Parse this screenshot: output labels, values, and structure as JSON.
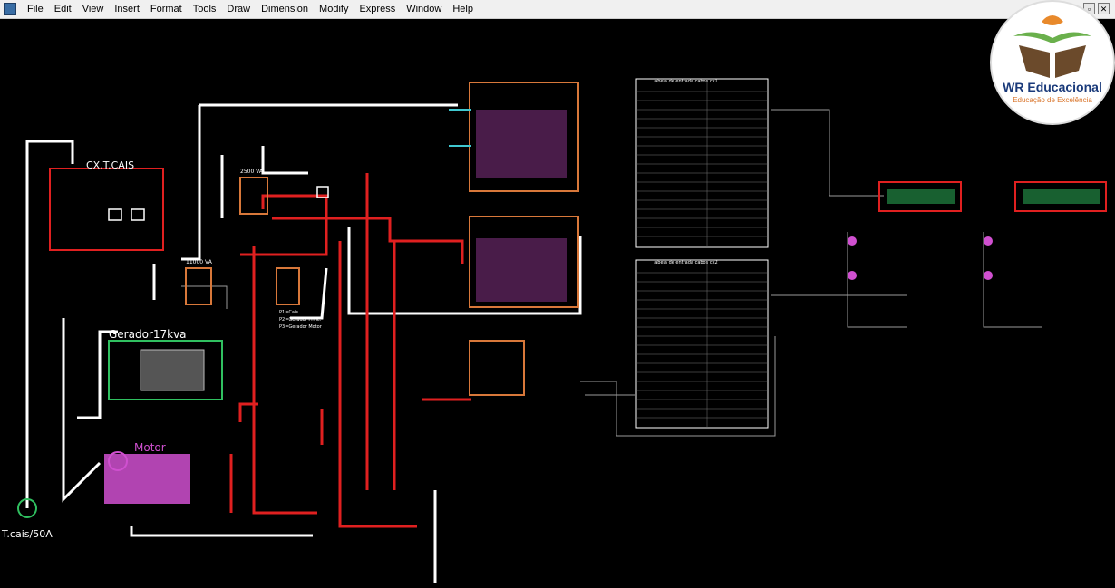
{
  "menu": {
    "items": [
      "File",
      "Edit",
      "View",
      "Insert",
      "Format",
      "Tools",
      "Draw",
      "Dimension",
      "Modify",
      "Express",
      "Window",
      "Help"
    ],
    "window_controls": [
      "▫",
      "✕"
    ]
  },
  "drawing": {
    "labels": {
      "cx_tcais": "CX.T.CAIS",
      "gerador": "Gerador17kva",
      "motor": "Motor",
      "tcais": "T.cais/50A",
      "kva_11000": "11000 VA",
      "kva_2500": "2500 VA",
      "p1": "P1=Cais",
      "p2": "P2=Gerador Princ.",
      "p3": "P3=Gerador Motor"
    },
    "table1_title": "Tabela de entrada cabos cx1",
    "table2_title": "Tabela de entrada cabos cx2"
  },
  "logo": {
    "title": "WR Educacional",
    "subtitle": "Educação de Excelência",
    "colors": {
      "green": "#6ab04c",
      "orange": "#e8892b",
      "brown": "#6b4a2b",
      "blue": "#1a3a7a"
    }
  },
  "colors": {
    "red": "#e02020",
    "white": "#ffffff",
    "magenta": "#d050d0",
    "orange": "#d8783a",
    "cyan": "#40c8d0",
    "green": "#30c060",
    "yellow": "#e8d040",
    "grayline": "#9a9a9a"
  }
}
